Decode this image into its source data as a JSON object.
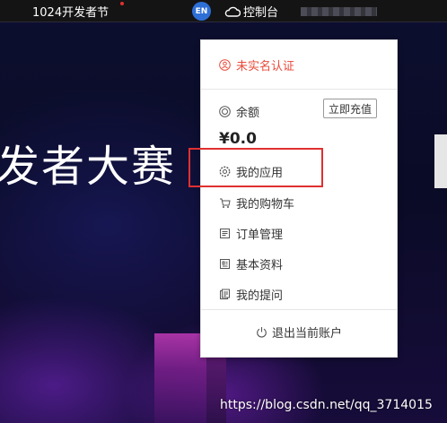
{
  "header": {
    "festival_link": "1024开发者节",
    "lang_badge": "EN",
    "console_label": "控制台"
  },
  "hero": {
    "title": "发者大赛"
  },
  "user_menu": {
    "verify_label": "未实名认证",
    "balance_label": "余额",
    "recharge_button": "立即充值",
    "balance_amount": "¥0.0",
    "items": [
      {
        "label": "我的应用",
        "icon": "gear-icon"
      },
      {
        "label": "我的购物车",
        "icon": "cart-icon"
      },
      {
        "label": "订单管理",
        "icon": "order-icon"
      },
      {
        "label": "基本资料",
        "icon": "profile-icon"
      },
      {
        "label": "我的提问",
        "icon": "question-icon"
      }
    ],
    "logout_label": "退出当前账户"
  },
  "watermark": "https://blog.csdn.net/qq_3714015",
  "colors": {
    "highlight_border": "#e03030",
    "verify_text": "#e84a3a",
    "lang_badge_bg": "#2e6fd6"
  }
}
